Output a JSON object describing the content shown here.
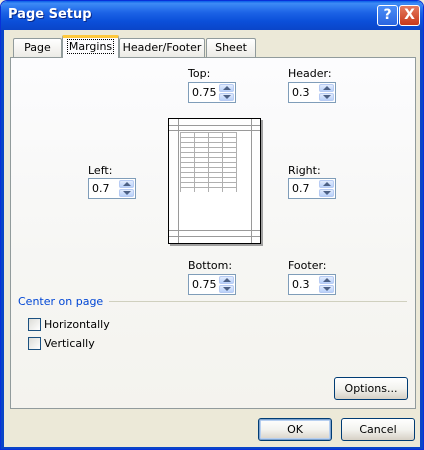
{
  "window": {
    "title": "Page Setup"
  },
  "titlebar_buttons": {
    "help": "?",
    "close": "X"
  },
  "tabs": [
    {
      "label": "Page",
      "active": false
    },
    {
      "label": "Margins",
      "active": true
    },
    {
      "label": "Header/Footer",
      "active": false
    },
    {
      "label": "Sheet",
      "active": false
    }
  ],
  "margins": {
    "top": {
      "label": "Top:",
      "value": "0.75"
    },
    "header": {
      "label": "Header:",
      "value": "0.3"
    },
    "left": {
      "label": "Left:",
      "value": "0.7"
    },
    "right": {
      "label": "Right:",
      "value": "0.7"
    },
    "bottom": {
      "label": "Bottom:",
      "value": "0.75"
    },
    "footer": {
      "label": "Footer:",
      "value": "0.3"
    }
  },
  "center_on_page": {
    "title": "Center on page",
    "horizontally": {
      "label": "Horizontally",
      "checked": false
    },
    "vertically": {
      "label": "Vertically",
      "checked": false
    }
  },
  "buttons": {
    "options": "Options...",
    "ok": "OK",
    "cancel": "Cancel"
  },
  "colors": {
    "titlebar": "#0a5fe8",
    "group_title": "#0046d5",
    "active_tab_accent": "#ffc83c"
  }
}
